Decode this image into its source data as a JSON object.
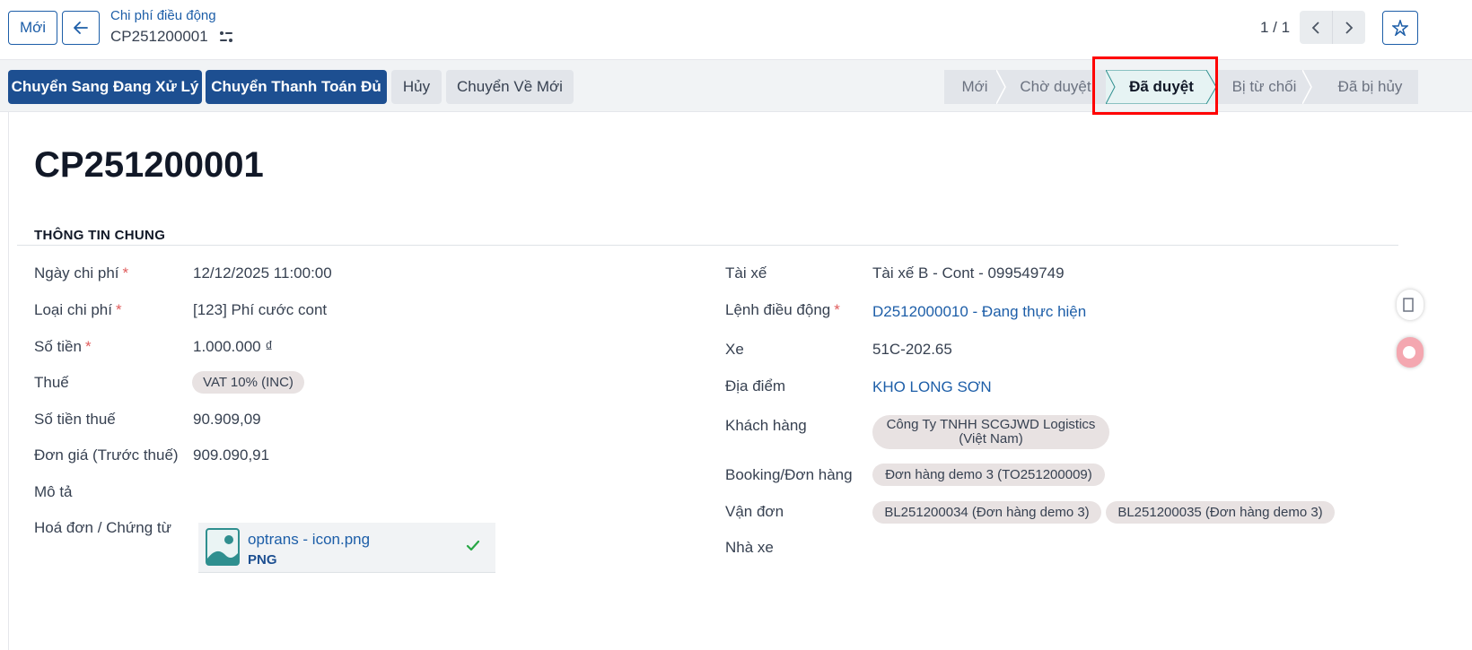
{
  "topbar": {
    "new_label": "Mới",
    "breadcrumb_parent": "Chi phí điều động",
    "breadcrumb_current": "CP251200001",
    "pager": "1 / 1"
  },
  "statusbar": {
    "actions": [
      "Chuyển Sang Đang Xử Lý",
      "Chuyển Thanh Toán Đủ",
      "Hủy",
      "Chuyển Về Mới"
    ],
    "stages": [
      "Mới",
      "Chờ duyệt",
      "Đã duyệt",
      "Bị từ chối",
      "Đã bị hủy"
    ],
    "active_stage": "Đã duyệt"
  },
  "record": {
    "title": "CP251200001",
    "section": "THÔNG TIN CHUNG"
  },
  "left_fields": {
    "ngay_chi_phi": {
      "label": "Ngày chi phí",
      "value": "12/12/2025 11:00:00"
    },
    "loai_chi_phi": {
      "label": "Loại chi phí",
      "value": "[123] Phí cước cont"
    },
    "so_tien": {
      "label": "Số tiền",
      "value": "1.000.000 ₫"
    },
    "thue": {
      "label": "Thuế",
      "value": "VAT 10% (INC)"
    },
    "so_tien_thue": {
      "label": "Số tiền thuế",
      "value": "90.909,09"
    },
    "don_gia": {
      "label": "Đơn giá (Trước thuế)",
      "value": "909.090,91"
    },
    "mo_ta": {
      "label": "Mô tả",
      "value": ""
    },
    "hoa_don": {
      "label": "Hoá đơn / Chứng từ",
      "file_name": "optrans - icon.png",
      "file_type": "PNG"
    }
  },
  "right_fields": {
    "tai_xe": {
      "label": "Tài xế",
      "value": "Tài xế B - Cont - 099549749"
    },
    "lenh_dieu_dong": {
      "label": "Lệnh điều động",
      "value": "D2512000010 - Đang thực hiện"
    },
    "xe": {
      "label": "Xe",
      "value": "51C-202.65"
    },
    "dia_diem": {
      "label": "Địa điểm",
      "value": "KHO LONG SƠN"
    },
    "khach_hang": {
      "label": "Khách hàng",
      "value_line1": "Công Ty TNHH SCGJWD Logistics",
      "value_line2": "(Việt Nam)"
    },
    "booking": {
      "label": "Booking/Đơn hàng",
      "value": "Đơn hàng demo 3 (TO251200009)"
    },
    "van_don": {
      "label": "Vận đơn",
      "values": [
        "BL251200034 (Đơn hàng demo 3)",
        "BL251200035 (Đơn hàng demo 3)"
      ]
    },
    "nha_xe": {
      "label": "Nhà xe",
      "value": ""
    }
  },
  "colors": {
    "primary": "#1d4f91",
    "link": "#1d5ea8",
    "highlight": "#ff0000",
    "active_stage_bg": "#e6f3f3"
  }
}
